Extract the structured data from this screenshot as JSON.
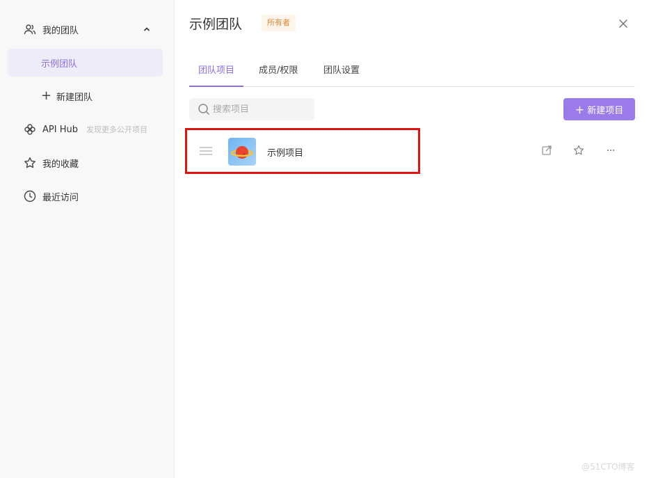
{
  "sidebar": {
    "my_team": "我的团队",
    "team_name": "示例团队",
    "new_team": "新建团队",
    "api_hub": "API Hub",
    "api_hub_hint": "发现更多公开项目",
    "favorites": "我的收藏",
    "recent": "最近访问"
  },
  "header": {
    "title": "示例团队",
    "owner_badge": "所有者"
  },
  "tabs": [
    "团队项目",
    "成员/权限",
    "团队设置"
  ],
  "search": {
    "placeholder": "搜索项目",
    "value": ""
  },
  "new_project_button": "新建项目",
  "projects": [
    {
      "name": "示例项目"
    }
  ],
  "watermark": "@51CTO博客",
  "colors": {
    "accent": "#9b7ae9",
    "highlight_border": "#e0140f",
    "badge_text": "#e08a3c"
  }
}
